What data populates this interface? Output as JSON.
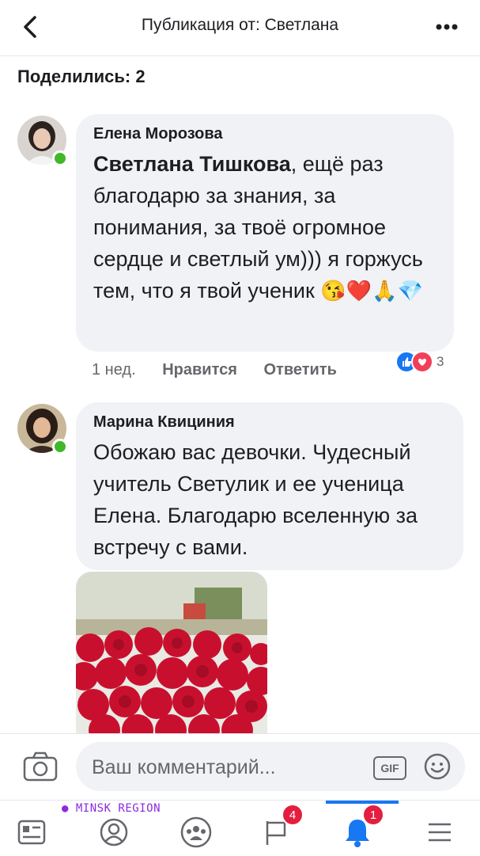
{
  "header": {
    "title": "Публикация от: Светлана"
  },
  "shared": {
    "label": "Поделились: 2"
  },
  "comments": [
    {
      "author": "Елена Морозова",
      "mention": "Светлана Тишкова",
      "text_after_mention": ", ещё раз благодарю за знания, за понимания, за твоё огромное сердце и светлый ум))) я горжусь тем, что я твой ученик",
      "emojis": "😘❤️🙏💎",
      "time": "1 нед.",
      "like": "Нравится",
      "reply": "Ответить",
      "reaction_count": "3"
    },
    {
      "author": "Марина Квициния",
      "text": "Обожаю вас девочки. Чудесный учитель  Светулик и ее ученица Елена. Благодарю вселенную за встречу с вами."
    }
  ],
  "composer": {
    "placeholder": "Ваш комментарий...",
    "gif": "GIF"
  },
  "nav": {
    "region": "MINSK REGION",
    "badge_pages": "4",
    "badge_notifications": "1"
  },
  "colors": {
    "accent": "#1877f2",
    "online": "#42b72a",
    "badge": "#e41e3f"
  }
}
